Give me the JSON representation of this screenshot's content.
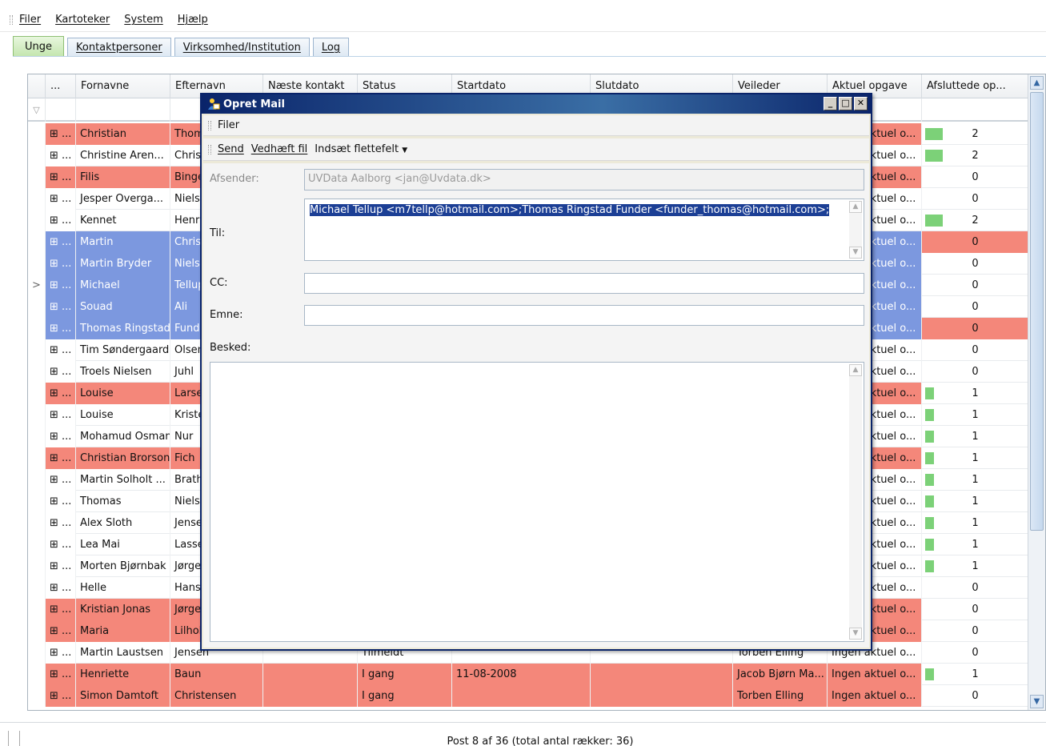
{
  "menubar": {
    "items": [
      "Filer",
      "Kartoteker",
      "System",
      "Hjælp"
    ]
  },
  "tabs": [
    "Unge",
    "Kontaktpersoner",
    "Virksomhed/Institution",
    "Log"
  ],
  "grid": {
    "columns": [
      "...",
      "Fornavne",
      "Efternavn",
      "Næste kontakt",
      "Status",
      "Startdato",
      "Slutdato",
      "Veileder",
      "Aktuel opgave",
      "Afsluttede op..."
    ],
    "rows": [
      {
        "color": "red",
        "marker": "",
        "expander": "⊞ ...",
        "fornavn": "Christian",
        "efternavn": "Thomsen",
        "status": "",
        "startdato": "",
        "veileder": "",
        "opgave": "Ingen aktuel o...",
        "afsl": "2",
        "bar": 0.34
      },
      {
        "color": "",
        "marker": "",
        "expander": "⊞ ...",
        "fornavn": "Christine Aren...",
        "efternavn": "Christensen",
        "status": "",
        "startdato": "",
        "veileder": "",
        "opgave": "Ingen aktuel o...",
        "afsl": "2",
        "bar": 0.34
      },
      {
        "color": "red",
        "marker": "",
        "expander": "⊞ ...",
        "fornavn": "Filis",
        "efternavn": "Binger",
        "status": "",
        "startdato": "",
        "veileder": "",
        "opgave": "Ingen aktuel o...",
        "afsl": "0",
        "bar": 0
      },
      {
        "color": "",
        "marker": "",
        "expander": "⊞ ...",
        "fornavn": "Jesper Overga...",
        "efternavn": "Nielsen",
        "status": "",
        "startdato": "",
        "veileder": "",
        "opgave": "Ingen aktuel o...",
        "afsl": "0",
        "bar": 0
      },
      {
        "color": "",
        "marker": "",
        "expander": "⊞ ...",
        "fornavn": "Kennet",
        "efternavn": "Henriksen",
        "status": "",
        "startdato": "",
        "veileder": "",
        "opgave": "Ingen aktuel o...",
        "afsl": "2",
        "bar": 0.34
      },
      {
        "color": "blue",
        "marker": "",
        "expander": "⊞ ...",
        "fornavn": "Martin",
        "efternavn": "Christensen",
        "status": "",
        "startdato": "",
        "veileder": "",
        "opgave": "Ingen aktuel o...",
        "afsl": "0",
        "bar": 0,
        "afslRed": true
      },
      {
        "color": "blue",
        "marker": "",
        "expander": "⊞ ...",
        "fornavn": "Martin Bryder",
        "efternavn": "Nielsen",
        "status": "",
        "startdato": "",
        "veileder": "",
        "opgave": "Ingen aktuel o...",
        "afsl": "0",
        "bar": 0
      },
      {
        "color": "blue",
        "marker": ">",
        "expander": "⊞ ...",
        "fornavn": "Michael",
        "efternavn": "Tellup",
        "status": "",
        "startdato": "",
        "veileder": "",
        "opgave": "Ingen aktuel o...",
        "afsl": "0",
        "bar": 0
      },
      {
        "color": "blue",
        "marker": "",
        "expander": "⊞ ...",
        "fornavn": "Souad",
        "efternavn": "Ali",
        "status": "",
        "startdato": "",
        "veileder": "",
        "opgave": "Ingen aktuel o...",
        "afsl": "0",
        "bar": 0
      },
      {
        "color": "blue",
        "marker": "",
        "expander": "⊞ ...",
        "fornavn": "Thomas Ringstad",
        "efternavn": "Funder",
        "status": "",
        "startdato": "",
        "veileder": "",
        "opgave": "Ingen aktuel o...",
        "afsl": "0",
        "bar": 0,
        "afslRed": true
      },
      {
        "color": "",
        "marker": "",
        "expander": "⊞ ...",
        "fornavn": "Tim Søndergaard",
        "efternavn": "Olsen",
        "status": "",
        "startdato": "",
        "veileder": "",
        "opgave": "Ingen aktuel o...",
        "afsl": "0",
        "bar": 0
      },
      {
        "color": "",
        "marker": "",
        "expander": "⊞ ...",
        "fornavn": "Troels Nielsen",
        "efternavn": "Juhl",
        "status": "",
        "startdato": "",
        "veileder": "",
        "opgave": "Ingen aktuel o...",
        "afsl": "0",
        "bar": 0
      },
      {
        "color": "red",
        "marker": "",
        "expander": "⊞ ...",
        "fornavn": "Louise",
        "efternavn": "Larsen",
        "status": "",
        "startdato": "",
        "veileder": "",
        "opgave": "Ingen aktuel o...",
        "afsl": "1",
        "bar": 0.17
      },
      {
        "color": "",
        "marker": "",
        "expander": "⊞ ...",
        "fornavn": "Louise",
        "efternavn": "Kristensen",
        "status": "",
        "startdato": "",
        "veileder": "",
        "opgave": "Ingen aktuel o...",
        "afsl": "1",
        "bar": 0.17
      },
      {
        "color": "",
        "marker": "",
        "expander": "⊞ ...",
        "fornavn": "Mohamud Osman",
        "efternavn": "Nur",
        "status": "",
        "startdato": "",
        "veileder": "",
        "opgave": "Ingen aktuel o...",
        "afsl": "1",
        "bar": 0.17
      },
      {
        "color": "red",
        "marker": "",
        "expander": "⊞ ...",
        "fornavn": "Christian Brorson",
        "efternavn": "Fich",
        "status": "",
        "startdato": "",
        "veileder": "",
        "opgave": "Ingen aktuel o...",
        "afsl": "1",
        "bar": 0.17
      },
      {
        "color": "",
        "marker": "",
        "expander": "⊞ ...",
        "fornavn": "Martin Solholt ...",
        "efternavn": "Brath",
        "status": "",
        "startdato": "",
        "veileder": "",
        "opgave": "Ingen aktuel o...",
        "afsl": "1",
        "bar": 0.17
      },
      {
        "color": "",
        "marker": "",
        "expander": "⊞ ...",
        "fornavn": "Thomas",
        "efternavn": "Nielsen",
        "status": "",
        "startdato": "",
        "veileder": "",
        "opgave": "Ingen aktuel o...",
        "afsl": "1",
        "bar": 0.17
      },
      {
        "color": "",
        "marker": "",
        "expander": "⊞ ...",
        "fornavn": "Alex Sloth",
        "efternavn": "Jensen",
        "status": "",
        "startdato": "",
        "veileder": "",
        "opgave": "Ingen aktuel o...",
        "afsl": "1",
        "bar": 0.17
      },
      {
        "color": "",
        "marker": "",
        "expander": "⊞ ...",
        "fornavn": "Lea Mai",
        "efternavn": "Lassen",
        "status": "",
        "startdato": "",
        "veileder": "",
        "opgave": "Ingen aktuel o...",
        "afsl": "1",
        "bar": 0.17
      },
      {
        "color": "",
        "marker": "",
        "expander": "⊞ ...",
        "fornavn": "Morten Bjørnbak",
        "efternavn": "Jørgensen",
        "status": "",
        "startdato": "",
        "veileder": "",
        "opgave": "Ingen aktuel o...",
        "afsl": "1",
        "bar": 0.17
      },
      {
        "color": "",
        "marker": "",
        "expander": "⊞ ...",
        "fornavn": "Helle",
        "efternavn": "Hansen",
        "status": "",
        "startdato": "",
        "veileder": "",
        "opgave": "Ingen aktuel o...",
        "afsl": "0",
        "bar": 0
      },
      {
        "color": "red",
        "marker": "",
        "expander": "⊞ ...",
        "fornavn": "Kristian Jonas",
        "efternavn": "Jørgensen",
        "status": "",
        "startdato": "",
        "veileder": "",
        "opgave": "Ingen aktuel o...",
        "afsl": "0",
        "bar": 0
      },
      {
        "color": "red",
        "marker": "",
        "expander": "⊞ ...",
        "fornavn": "Maria",
        "efternavn": "Lilholt",
        "status": "",
        "startdato": "",
        "veileder": "",
        "opgave": "Ingen aktuel o...",
        "afsl": "0",
        "bar": 0
      },
      {
        "color": "",
        "marker": "",
        "expander": "⊞ ...",
        "fornavn": "Martin Laustsen",
        "efternavn": "Jensen",
        "status": "Tilmeldt",
        "startdato": "",
        "veileder": "Torben Elling",
        "opgave": "Ingen aktuel o...",
        "afsl": "0",
        "bar": 0
      },
      {
        "color": "red",
        "marker": "",
        "expander": "⊞ ...",
        "fornavn": "Henriette",
        "efternavn": "Baun",
        "status": "I gang",
        "startdato": "11-08-2008",
        "veileder": "Jacob Bjørn Ma...",
        "opgave": "Ingen aktuel o...",
        "afsl": "1",
        "bar": 0.17
      },
      {
        "color": "red",
        "marker": "",
        "expander": "⊞ ...",
        "fornavn": "Simon Damtoft",
        "efternavn": "Christensen",
        "status": "I gang",
        "startdato": "",
        "veileder": "Torben Elling",
        "opgave": "Ingen aktuel o...",
        "afsl": "0",
        "bar": 0
      }
    ]
  },
  "statusbar": {
    "text": "Post 8 af 36 (total antal rækker: 36)"
  },
  "dialog": {
    "title": "Opret Mail",
    "menu": "Filer",
    "toolbar": {
      "send": "Send",
      "attach": "Vedhæft fil",
      "insert": "Indsæt flettefelt"
    },
    "labels": {
      "from": "Afsender:",
      "to": "Til:",
      "cc": "CC:",
      "subject": "Emne:",
      "message": "Besked:"
    },
    "from_value": "UVData Aalborg <jan@Uvdata.dk>",
    "to_value": "Michael Tellup <m7tellp@hotmail.com>;Thomas Ringstad Funder <funder_thomas@hotmail.com>;",
    "cc_value": "",
    "subject_value": "",
    "message_value": ""
  },
  "colors": {
    "red_row": "#f4877a",
    "blue_row": "#7c98df",
    "bar": "#7cd178",
    "dialog_title": "#0a246a"
  }
}
